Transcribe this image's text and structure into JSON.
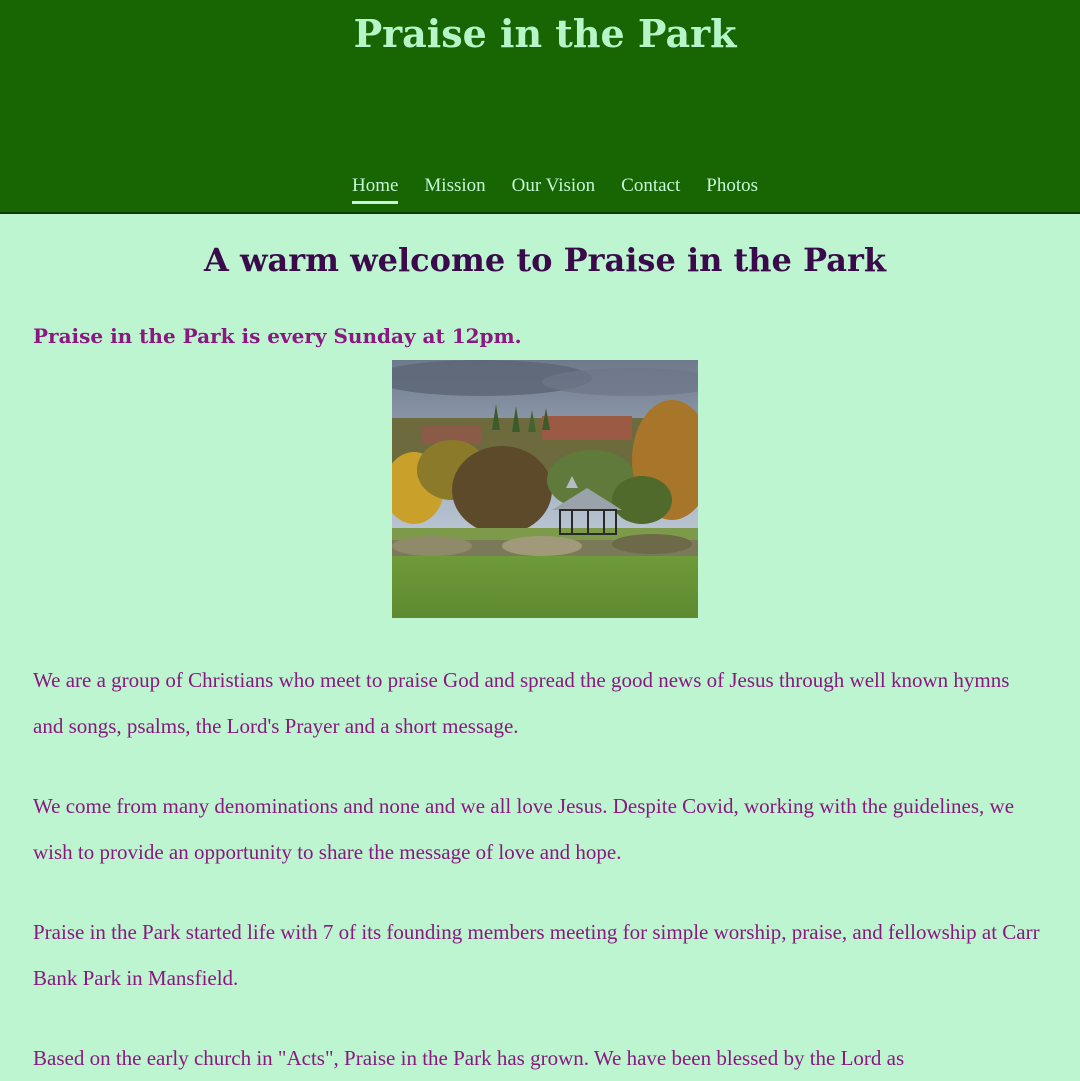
{
  "header": {
    "title": "Praise in the Park",
    "nav": [
      {
        "label": "Home",
        "active": true
      },
      {
        "label": "Mission",
        "active": false
      },
      {
        "label": "Our Vision",
        "active": false
      },
      {
        "label": "Contact",
        "active": false
      },
      {
        "label": "Photos",
        "active": false
      }
    ]
  },
  "main": {
    "heading": "A warm welcome to Praise in the Park",
    "schedule": "Praise in the Park is every Sunday at 12pm.",
    "paragraphs": [
      "We are a group of Christians who meet to praise God and spread the good news of Jesus through well known hymns and songs, psalms, the Lord's Prayer and a short message.",
      "We come from many denominations and none and we all love Jesus. Despite Covid, working with the guidelines, we wish to provide an opportunity to share the message of love and hope.",
      "Praise in the Park started life with 7 of its founding members meeting for simple worship, praise, and fellowship at Carr Bank Park in Mansfield.",
      "Based on the early church in \"Acts\", Praise in the Park has grown. We have been blessed by the Lord as"
    ]
  },
  "colors": {
    "header_bg": "#186603",
    "page_bg": "#bcf5d0",
    "title_color": "#b6f5c8",
    "heading_color": "#3a0a4a",
    "text_color": "#8a1880"
  }
}
